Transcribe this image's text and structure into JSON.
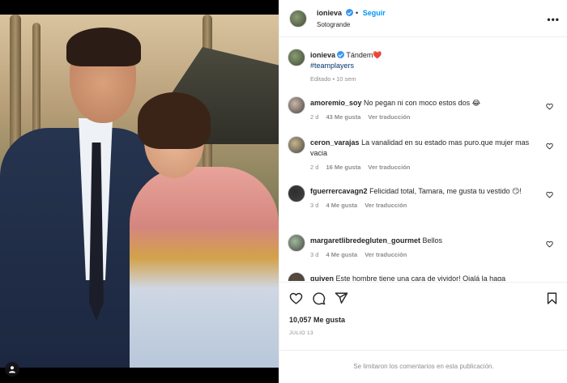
{
  "post": {
    "username": "ionieva",
    "follow_label": "Seguir",
    "separator": "•",
    "location": "Sotogrande",
    "more_label": "•••",
    "caption": {
      "text": "Tándem",
      "emoji": "❤️",
      "hashtag": "#teamplayers",
      "edited": "Editado",
      "age": "10 sem"
    }
  },
  "comments": [
    {
      "user": "amoremio_soy",
      "text": "No pegan ni con moco estos dos 😂",
      "age": "2 d",
      "likes": "43 Me gusta",
      "translate": "Ver traducción",
      "avatar_color": "#c9b6a5"
    },
    {
      "user": "ceron_varajas",
      "text": "La vanalidad en su estado mas puro.que mujer mas vacia",
      "age": "2 d",
      "likes": "16 Me gusta",
      "translate": "Ver traducción",
      "avatar_color": "#c7b58a"
    },
    {
      "user": "fguerrercavagn2",
      "text": "Felicidad total, Tamara, me gusta tu vestido 😏!",
      "age": "3 d",
      "likes": "4 Me gusta",
      "translate": "Ver traducción",
      "avatar_color": "#2e2e2e"
    },
    {
      "user": "margaretlibredegluten_gourmet",
      "text": "Bellos",
      "age": "3 d",
      "likes": "4 Me gusta",
      "translate": "Ver traducción",
      "avatar_color": "#9fb89a"
    },
    {
      "user": "quiven",
      "text": "Este hombre tiene una cara de vividor! Ojalá la haga",
      "age": "",
      "likes": "",
      "translate": "",
      "avatar_color": "#5a4a3c"
    }
  ],
  "footer": {
    "likes": "10,057 Me gusta",
    "date": "JULIO 13",
    "comments_limited": "Se limitaron los comentarios en esta publicación."
  },
  "colors": {
    "accent": "#0095f6",
    "verified": "#3897f0",
    "muted": "#8e8e8e",
    "text": "#262626"
  },
  "icons": [
    "user-tag-icon",
    "verified-icon",
    "more-icon",
    "heart-icon",
    "comment-icon",
    "share-icon",
    "bookmark-icon"
  ]
}
